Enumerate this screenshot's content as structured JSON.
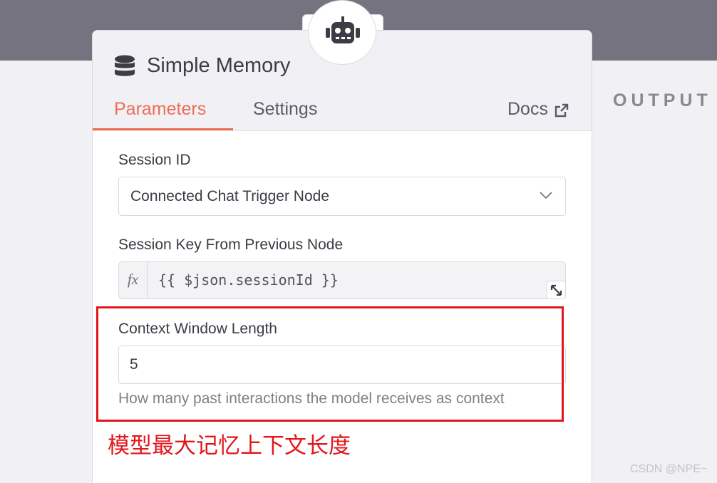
{
  "node": {
    "icon": "robot-icon",
    "title": "Simple Memory",
    "title_icon": "database-icon"
  },
  "tabs": {
    "parameters": "Parameters",
    "settings": "Settings",
    "docs": "Docs",
    "docs_icon": "external-link-icon"
  },
  "fields": {
    "session_id": {
      "label": "Session ID",
      "value": "Connected Chat Trigger Node"
    },
    "session_key": {
      "label": "Session Key From Previous Node",
      "fx": "fx",
      "value": "{{ $json.sessionId }}"
    },
    "context_window": {
      "label": "Context Window Length",
      "value": "5",
      "hint": "How many past interactions the model receives as context"
    }
  },
  "output_label": "OUTPUT",
  "annotation": {
    "text": "模型最大记忆上下文长度",
    "color": "#e2161b"
  },
  "watermark": "CSDN @NPE~",
  "colors": {
    "accent": "#ee6d55",
    "header_bg": "#f1f1f5",
    "top_band": "#75737f"
  }
}
